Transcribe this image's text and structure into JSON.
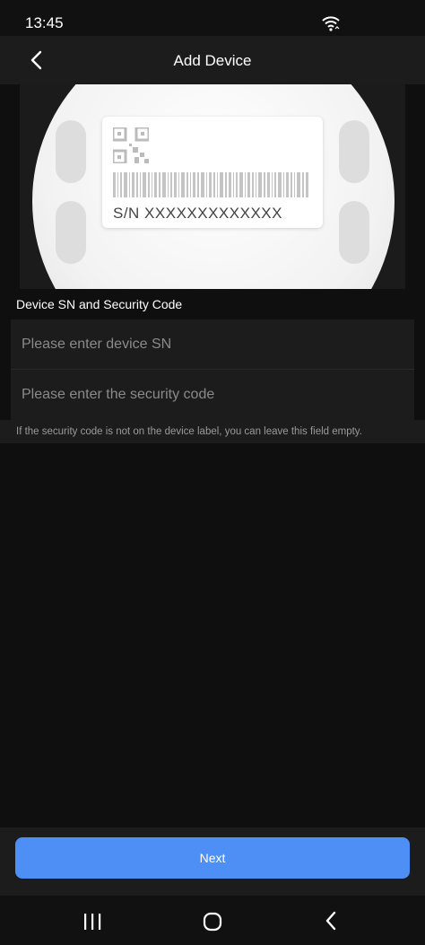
{
  "status_bar": {
    "time": "13:45",
    "wifi_icon": "wifi-icon"
  },
  "header": {
    "title": "Add Device",
    "back_icon": "chevron-left-icon"
  },
  "illustration": {
    "sn_label": "S/N  XXXXXXXXXXXXX"
  },
  "form": {
    "section_label": "Device SN and Security Code",
    "sn_placeholder": "Please enter device SN",
    "sn_value": "",
    "code_placeholder": "Please enter the security code",
    "code_value": "",
    "hint": "If the security code is not on the device label, you can leave this field empty."
  },
  "footer": {
    "next_label": "Next"
  },
  "nav": {
    "recents_icon": "recents-icon",
    "home_icon": "home-icon",
    "back_icon": "back-icon"
  },
  "colors": {
    "accent": "#4e8ff5",
    "background": "#0f0f0f",
    "surface": "#1c1c1c"
  }
}
